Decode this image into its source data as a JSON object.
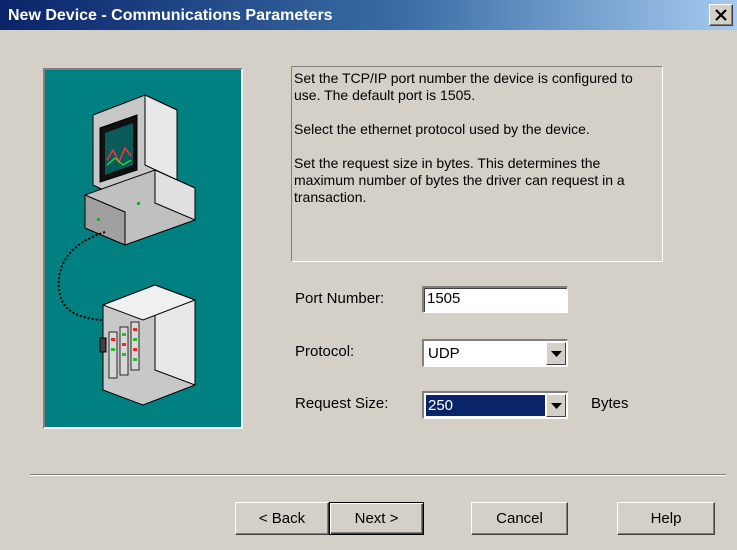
{
  "window": {
    "title": "New Device - Communications Parameters",
    "close_glyph": "✕"
  },
  "info": {
    "paragraph_1": "Set the TCP/IP port number the device is configured to use.  The  default port is 1505.",
    "paragraph_2": "Select the ethernet protocol used by the device.",
    "paragraph_3": "Set the request size in bytes.  This determines the maximum number of bytes the driver can request in a transaction."
  },
  "form": {
    "port_label": "Port Number:",
    "port_value": "1505",
    "protocol_label": "Protocol:",
    "protocol_value": "UDP",
    "request_size_label": "Request Size:",
    "request_size_value": "250",
    "request_size_unit": "Bytes"
  },
  "buttons": {
    "back": "< Back",
    "next": "Next >",
    "cancel": "Cancel",
    "help": "Help"
  },
  "illustration": {
    "icon": "computer-connected-to-device-icon",
    "background_color": "#008080"
  },
  "colors": {
    "title_bar": "#0a246a",
    "dialog_face": "#d4d0c8",
    "selection": "#0a246a"
  }
}
